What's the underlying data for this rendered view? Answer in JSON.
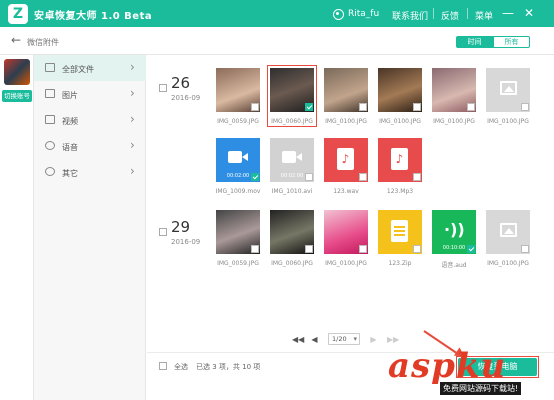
{
  "titlebar": {
    "app_title": "安卓恢复大师 1.0 Beta",
    "logo_letter": "Z",
    "user_name": "Rita_fu",
    "contact_label": "联系我们",
    "feedback_label": "反馈",
    "menu_label": "菜单",
    "minimize_glyph": "—",
    "close_glyph": "✕",
    "accent_color": "#1abc9c"
  },
  "subbar": {
    "back_glyph": "←",
    "breadcrumb": "微信附件",
    "sort_time_label": "时间",
    "sort_all_label": "所有"
  },
  "account": {
    "switch_label": "切换账号"
  },
  "sidebar": {
    "items": [
      {
        "label": "全部文件",
        "icon": "folder-icon",
        "active": true
      },
      {
        "label": "图片",
        "icon": "image-icon",
        "active": false
      },
      {
        "label": "视频",
        "icon": "video-icon",
        "active": false
      },
      {
        "label": "语音",
        "icon": "voice-icon",
        "active": false
      },
      {
        "label": "其它",
        "icon": "other-icon",
        "active": false
      }
    ],
    "chevron_glyph": "›"
  },
  "groups": [
    {
      "day": "26",
      "month": "2016-09",
      "files": [
        {
          "name": "IMG_0059.JPG",
          "kind": "photo",
          "checked": false
        },
        {
          "name": "IMG_0060.JPG",
          "kind": "photo",
          "checked": true
        },
        {
          "name": "IMG_0100.JPG",
          "kind": "photo",
          "checked": false
        },
        {
          "name": "IMG_0100.JPG",
          "kind": "photo",
          "checked": false
        },
        {
          "name": "IMG_0100.JPG",
          "kind": "photo",
          "checked": false
        },
        {
          "name": "IMG_0100.JPG",
          "kind": "placeholder",
          "checked": false
        },
        {
          "name": "IMG_1009.mov",
          "kind": "video",
          "checked": true,
          "duration": "00:02:00"
        },
        {
          "name": "IMG_1010.avi",
          "kind": "video-gray",
          "checked": false,
          "duration": "00:02:00"
        },
        {
          "name": "123.wav",
          "kind": "audio",
          "checked": false
        },
        {
          "name": "123.Mp3",
          "kind": "audio",
          "checked": false
        }
      ]
    },
    {
      "day": "29",
      "month": "2016-09",
      "files": [
        {
          "name": "IMG_0059.JPG",
          "kind": "photo",
          "checked": false
        },
        {
          "name": "IMG_0060.JPG",
          "kind": "photo",
          "checked": false
        },
        {
          "name": "IMG_0100.JPG",
          "kind": "photo",
          "checked": false
        },
        {
          "name": "123.Zip",
          "kind": "zip",
          "checked": false
        },
        {
          "name": "语音.aud",
          "kind": "voice",
          "checked": true,
          "duration": "00:10:00"
        },
        {
          "name": "IMG_0100.JPG",
          "kind": "placeholder",
          "checked": false
        }
      ]
    }
  ],
  "pager": {
    "first_glyph": "◀◀",
    "prev_glyph": "◀",
    "page_value": "1/20",
    "next_glyph": "▶",
    "last_glyph": "▶▶"
  },
  "footer": {
    "select_all_label": "全选",
    "selection_info": "已选 3 项，共 10 项",
    "recover_label": "恢复到电脑"
  },
  "watermark": {
    "brand": "aspku",
    "sub": "免费网站源码下载站!"
  }
}
